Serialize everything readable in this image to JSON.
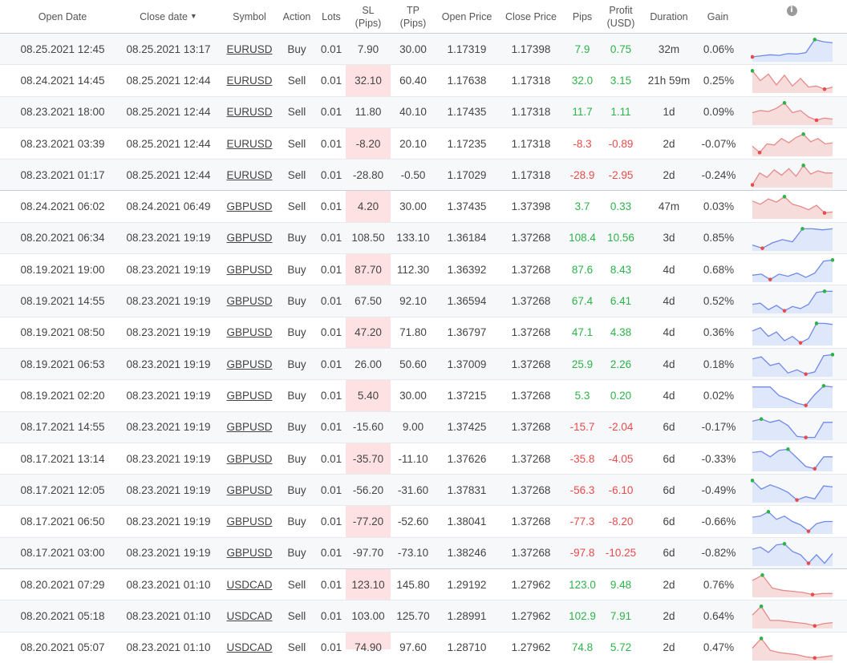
{
  "headers": {
    "open_date": "Open Date",
    "close_date": "Close date",
    "close_date_sort": "▼",
    "symbol": "Symbol",
    "action": "Action",
    "lots": "Lots",
    "sl_1": "SL",
    "sl_2": "(Pips)",
    "tp_1": "TP",
    "tp_2": "(Pips)",
    "open_price": "Open Price",
    "close_price": "Close Price",
    "pips": "Pips",
    "profit_1": "Profit",
    "profit_2": "(USD)",
    "duration": "Duration",
    "gain": "Gain",
    "info_icon": "i"
  },
  "colors": {
    "positive": "#2eb34a",
    "negative": "#e84b4b",
    "sl_band": "#fde1e3",
    "spark_buy_fill": "#dfe7fb",
    "spark_buy_line": "#6f89ea",
    "spark_sell_fill": "#f7dcdc",
    "spark_sell_line": "#e58a8a"
  },
  "trades": [
    {
      "open": "08.25.2021 12:45",
      "close": "08.25.2021 13:17",
      "symbol": "EURUSD",
      "action": "Buy",
      "lots": "0.01",
      "sl": "7.90",
      "tp": "30.00",
      "open_price": "1.17319",
      "close_price": "1.17398",
      "pips": "7.9",
      "profit": "0.75",
      "duration": "32m",
      "gain": "0.06%",
      "positive": true,
      "group_start": true,
      "spark": [
        0.15,
        0.2,
        0.25,
        0.22,
        0.3,
        0.28,
        0.35,
        0.95,
        0.85,
        0.8
      ]
    },
    {
      "open": "08.24.2021 14:45",
      "close": "08.25.2021 12:44",
      "symbol": "EURUSD",
      "action": "Sell",
      "lots": "0.01",
      "sl": "32.10",
      "tp": "60.40",
      "open_price": "1.17638",
      "close_price": "1.17318",
      "pips": "32.0",
      "profit": "3.15",
      "duration": "21h 59m",
      "gain": "0.25%",
      "positive": true,
      "spark": [
        0.95,
        0.5,
        0.8,
        0.3,
        0.75,
        0.25,
        0.6,
        0.2,
        0.25,
        0.1,
        0.2
      ]
    },
    {
      "open": "08.23.2021 18:00",
      "close": "08.25.2021 12:44",
      "symbol": "EURUSD",
      "action": "Sell",
      "lots": "0.01",
      "sl": "11.80",
      "tp": "40.10",
      "open_price": "1.17435",
      "close_price": "1.17318",
      "pips": "11.7",
      "profit": "1.11",
      "duration": "1d",
      "gain": "0.09%",
      "positive": true,
      "spark": [
        0.5,
        0.6,
        0.55,
        0.7,
        0.95,
        0.5,
        0.6,
        0.3,
        0.15,
        0.25,
        0.2
      ]
    },
    {
      "open": "08.23.2021 03:39",
      "close": "08.25.2021 12:44",
      "symbol": "EURUSD",
      "action": "Sell",
      "lots": "0.01",
      "sl": "-8.20",
      "tp": "20.10",
      "open_price": "1.17235",
      "close_price": "1.17318",
      "pips": "-8.3",
      "profit": "-0.89",
      "duration": "2d",
      "gain": "-0.07%",
      "positive": false,
      "spark": [
        0.4,
        0.1,
        0.5,
        0.45,
        0.75,
        0.55,
        0.8,
        0.95,
        0.6,
        0.75,
        0.5,
        0.55
      ]
    },
    {
      "open": "08.23.2021 01:17",
      "close": "08.25.2021 12:44",
      "symbol": "EURUSD",
      "action": "Sell",
      "lots": "0.01",
      "sl": "-28.80",
      "tp": "-0.50",
      "open_price": "1.17029",
      "close_price": "1.17318",
      "pips": "-28.9",
      "profit": "-2.95",
      "duration": "2d",
      "gain": "-0.24%",
      "positive": false,
      "spark": [
        0.05,
        0.6,
        0.4,
        0.75,
        0.5,
        0.8,
        0.45,
        0.95,
        0.55,
        0.7,
        0.6,
        0.6
      ]
    },
    {
      "open": "08.24.2021 06:02",
      "close": "08.24.2021 06:49",
      "symbol": "GBPUSD",
      "action": "Sell",
      "lots": "0.01",
      "sl": "4.20",
      "tp": "30.00",
      "open_price": "1.37435",
      "close_price": "1.37398",
      "pips": "3.7",
      "profit": "0.33",
      "duration": "47m",
      "gain": "0.03%",
      "positive": true,
      "group_start": true,
      "spark": [
        0.75,
        0.6,
        0.85,
        0.7,
        0.95,
        0.6,
        0.5,
        0.35,
        0.55,
        0.2,
        0.25
      ]
    },
    {
      "open": "08.20.2021 06:34",
      "close": "08.23.2021 19:19",
      "symbol": "GBPUSD",
      "action": "Buy",
      "lots": "0.01",
      "sl": "108.50",
      "tp": "133.10",
      "open_price": "1.36184",
      "close_price": "1.37268",
      "pips": "108.4",
      "profit": "10.56",
      "duration": "3d",
      "gain": "0.85%",
      "positive": true,
      "spark": [
        0.2,
        0.05,
        0.3,
        0.45,
        0.35,
        0.95,
        0.95,
        0.9,
        0.95
      ]
    },
    {
      "open": "08.19.2021 19:00",
      "close": "08.23.2021 19:19",
      "symbol": "GBPUSD",
      "action": "Buy",
      "lots": "0.01",
      "sl": "87.70",
      "tp": "112.30",
      "open_price": "1.36392",
      "close_price": "1.37268",
      "pips": "87.6",
      "profit": "8.43",
      "duration": "4d",
      "gain": "0.68%",
      "positive": true,
      "spark": [
        0.25,
        0.3,
        0.05,
        0.3,
        0.2,
        0.35,
        0.15,
        0.35,
        0.9,
        0.95
      ]
    },
    {
      "open": "08.19.2021 14:55",
      "close": "08.23.2021 19:19",
      "symbol": "GBPUSD",
      "action": "Buy",
      "lots": "0.01",
      "sl": "67.50",
      "tp": "92.10",
      "open_price": "1.36594",
      "close_price": "1.37268",
      "pips": "67.4",
      "profit": "6.41",
      "duration": "4d",
      "gain": "0.52%",
      "positive": true,
      "spark": [
        0.35,
        0.4,
        0.1,
        0.3,
        0.05,
        0.25,
        0.15,
        0.35,
        0.9,
        0.95,
        0.95
      ]
    },
    {
      "open": "08.19.2021 08:50",
      "close": "08.23.2021 19:19",
      "symbol": "GBPUSD",
      "action": "Buy",
      "lots": "0.01",
      "sl": "47.20",
      "tp": "71.80",
      "open_price": "1.36797",
      "close_price": "1.37268",
      "pips": "47.1",
      "profit": "4.38",
      "duration": "4d",
      "gain": "0.36%",
      "positive": true,
      "spark": [
        0.6,
        0.75,
        0.35,
        0.55,
        0.15,
        0.35,
        0.05,
        0.25,
        0.95,
        0.95,
        0.9
      ]
    },
    {
      "open": "08.19.2021 06:53",
      "close": "08.23.2021 19:19",
      "symbol": "GBPUSD",
      "action": "Buy",
      "lots": "0.01",
      "sl": "26.00",
      "tp": "50.60",
      "open_price": "1.37009",
      "close_price": "1.37268",
      "pips": "25.9",
      "profit": "2.26",
      "duration": "4d",
      "gain": "0.18%",
      "positive": true,
      "spark": [
        0.75,
        0.85,
        0.45,
        0.55,
        0.1,
        0.25,
        0.05,
        0.15,
        0.9,
        0.95
      ]
    },
    {
      "open": "08.19.2021 02:20",
      "close": "08.23.2021 19:19",
      "symbol": "GBPUSD",
      "action": "Buy",
      "lots": "0.01",
      "sl": "5.40",
      "tp": "30.00",
      "open_price": "1.37215",
      "close_price": "1.37268",
      "pips": "5.3",
      "profit": "0.20",
      "duration": "4d",
      "gain": "0.02%",
      "positive": true,
      "spark": [
        0.9,
        0.9,
        0.9,
        0.5,
        0.35,
        0.15,
        0.05,
        0.55,
        0.95,
        0.9
      ]
    },
    {
      "open": "08.17.2021 14:55",
      "close": "08.23.2021 19:19",
      "symbol": "GBPUSD",
      "action": "Buy",
      "lots": "0.01",
      "sl": "-15.60",
      "tp": "9.00",
      "open_price": "1.37425",
      "close_price": "1.37268",
      "pips": "-15.7",
      "profit": "-2.04",
      "duration": "6d",
      "gain": "-0.17%",
      "positive": false,
      "spark": [
        0.8,
        0.9,
        0.75,
        0.85,
        0.6,
        0.1,
        0.05,
        0.05,
        0.75,
        0.75
      ]
    },
    {
      "open": "08.17.2021 13:14",
      "close": "08.23.2021 19:19",
      "symbol": "GBPUSD",
      "action": "Buy",
      "lots": "0.01",
      "sl": "-35.70",
      "tp": "-11.10",
      "open_price": "1.37626",
      "close_price": "1.37268",
      "pips": "-35.8",
      "profit": "-4.05",
      "duration": "6d",
      "gain": "-0.33%",
      "positive": false,
      "spark": [
        0.8,
        0.85,
        0.6,
        0.9,
        0.95,
        0.55,
        0.15,
        0.05,
        0.6,
        0.6
      ]
    },
    {
      "open": "08.17.2021 12:05",
      "close": "08.23.2021 19:19",
      "symbol": "GBPUSD",
      "action": "Buy",
      "lots": "0.01",
      "sl": "-56.20",
      "tp": "-31.60",
      "open_price": "1.37831",
      "close_price": "1.37268",
      "pips": "-56.3",
      "profit": "-6.10",
      "duration": "6d",
      "gain": "-0.49%",
      "positive": false,
      "spark": [
        0.95,
        0.55,
        0.75,
        0.6,
        0.4,
        0.05,
        0.2,
        0.1,
        0.7,
        0.65
      ]
    },
    {
      "open": "08.17.2021 06:50",
      "close": "08.23.2021 19:19",
      "symbol": "GBPUSD",
      "action": "Buy",
      "lots": "0.01",
      "sl": "-77.20",
      "tp": "-52.60",
      "open_price": "1.38041",
      "close_price": "1.37268",
      "pips": "-77.3",
      "profit": "-8.20",
      "duration": "6d",
      "gain": "-0.66%",
      "positive": false,
      "spark": [
        0.7,
        0.75,
        0.95,
        0.6,
        0.75,
        0.5,
        0.35,
        0.05,
        0.4,
        0.5,
        0.5
      ]
    },
    {
      "open": "08.17.2021 03:00",
      "close": "08.23.2021 19:19",
      "symbol": "GBPUSD",
      "action": "Buy",
      "lots": "0.01",
      "sl": "-97.70",
      "tp": "-73.10",
      "open_price": "1.38246",
      "close_price": "1.37268",
      "pips": "-97.8",
      "profit": "-10.25",
      "duration": "6d",
      "gain": "-0.82%",
      "positive": false,
      "spark": [
        0.7,
        0.8,
        0.55,
        0.9,
        0.95,
        0.6,
        0.45,
        0.05,
        0.45,
        0.05,
        0.5
      ]
    },
    {
      "open": "08.20.2021 07:29",
      "close": "08.23.2021 01:10",
      "symbol": "USDCAD",
      "action": "Sell",
      "lots": "0.01",
      "sl": "123.10",
      "tp": "145.80",
      "open_price": "1.29192",
      "close_price": "1.27962",
      "pips": "123.0",
      "profit": "9.48",
      "duration": "2d",
      "gain": "0.76%",
      "positive": true,
      "group_start": true,
      "spark": [
        0.7,
        0.95,
        0.35,
        0.25,
        0.2,
        0.15,
        0.05,
        0.1,
        0.1
      ]
    },
    {
      "open": "08.20.2021 05:18",
      "close": "08.23.2021 01:10",
      "symbol": "USDCAD",
      "action": "Sell",
      "lots": "0.01",
      "sl": "103.00",
      "tp": "125.70",
      "open_price": "1.28991",
      "close_price": "1.27962",
      "pips": "102.9",
      "profit": "7.91",
      "duration": "2d",
      "gain": "0.64%",
      "positive": true,
      "spark": [
        0.55,
        0.95,
        0.3,
        0.3,
        0.25,
        0.2,
        0.15,
        0.05,
        0.15,
        0.2
      ]
    },
    {
      "open": "08.20.2021 05:07",
      "close": "08.23.2021 01:10",
      "symbol": "USDCAD",
      "action": "Sell",
      "lots": "0.01",
      "sl": "74.90",
      "tp": "97.60",
      "open_price": "1.28710",
      "close_price": "1.27962",
      "pips": "74.8",
      "profit": "5.72",
      "duration": "2d",
      "gain": "0.47%",
      "positive": true,
      "spark": [
        0.5,
        0.95,
        0.4,
        0.3,
        0.25,
        0.2,
        0.1,
        0.05,
        0.1,
        0.15
      ]
    }
  ]
}
